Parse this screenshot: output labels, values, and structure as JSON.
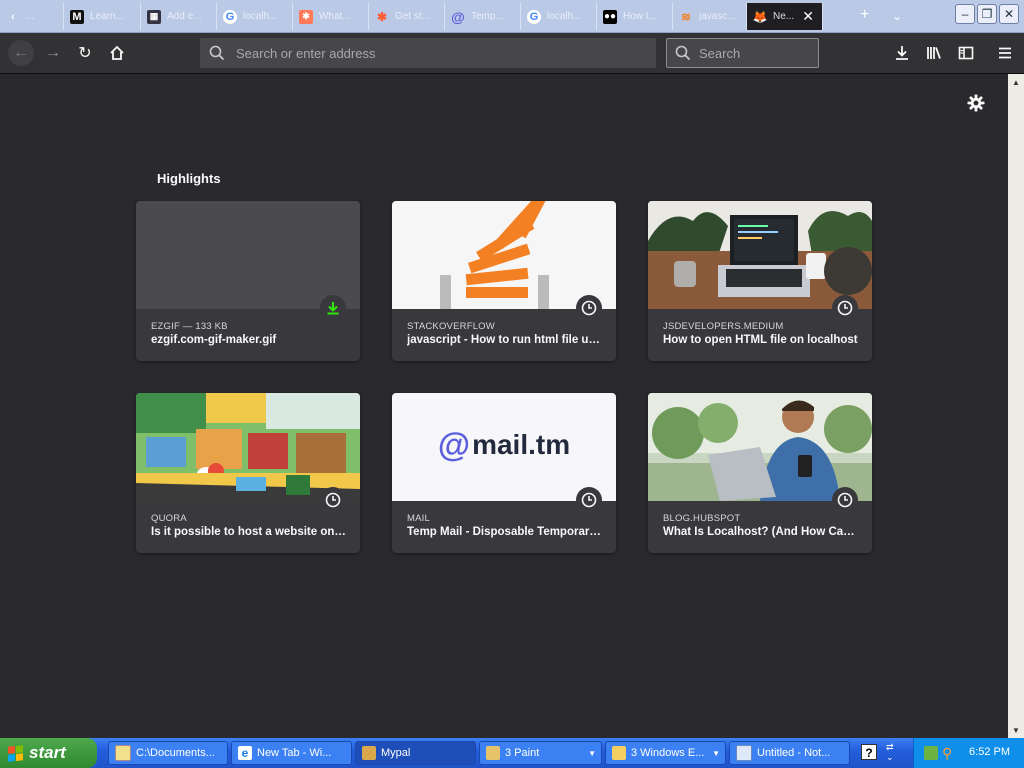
{
  "tabs": [
    {
      "label": "...",
      "icon": "tab-icon"
    },
    {
      "label": "Learn...",
      "icon": "medium-icon"
    },
    {
      "label": "Add e...",
      "icon": "grid-icon"
    },
    {
      "label": "localh...",
      "icon": "google-icon"
    },
    {
      "label": "What...",
      "icon": "hubspot-icon"
    },
    {
      "label": "Get st...",
      "icon": "hubspot-icon"
    },
    {
      "label": "Temp...",
      "icon": "at-icon"
    },
    {
      "label": "localh...",
      "icon": "google-icon"
    },
    {
      "label": "How t...",
      "icon": "medium-dots-icon"
    },
    {
      "label": "javasc...",
      "icon": "stackoverflow-icon"
    },
    {
      "label": "Ne...",
      "icon": "firefox-icon",
      "active": true
    }
  ],
  "toolbar": {
    "address_placeholder": "Search or enter address",
    "search_placeholder": "Search"
  },
  "highlights": {
    "title": "Highlights",
    "cards": [
      {
        "host": "EZGIF — 133 KB",
        "title": "ezgif.com-gif-maker.gif",
        "badge": "download"
      },
      {
        "host": "STACKOVERFLOW",
        "title": "javascript - How to run html file using node js - Stack Overflow",
        "badge": "history"
      },
      {
        "host": "JSDEVELOPERS.MEDIUM",
        "title": "How to open HTML file on localhost",
        "badge": "history"
      },
      {
        "host": "QUORA",
        "title": "Is it possible to host a website on localhost?",
        "badge": "history"
      },
      {
        "host": "MAIL",
        "title": "Temp Mail - Disposable Temporary Email",
        "badge": "history",
        "logo_text": "mail.tm"
      },
      {
        "host": "BLOG.HUBSPOT",
        "title": "What Is Localhost? (And How Can I Use It?)",
        "badge": "history"
      }
    ]
  },
  "taskbar": {
    "start_label": "start",
    "tasks": [
      {
        "label": "C:\\Documents...",
        "icon": "cmd-icon"
      },
      {
        "label": "New Tab - Wi...",
        "icon": "ie-icon"
      },
      {
        "label": "Mypal",
        "icon": "mypal-icon",
        "active": true
      },
      {
        "label": "3 Paint",
        "icon": "paint-icon"
      },
      {
        "label": "3 Windows E...",
        "icon": "folder-icon"
      },
      {
        "label": "Untitled - Not...",
        "icon": "notepad-icon"
      }
    ],
    "clock": "6:52 PM"
  },
  "colors": {
    "content_bg": "#2a2a2e",
    "card_bg": "#38383d",
    "download_green": "#30e60b",
    "taskbar_blue": "#245edc",
    "start_green": "#3c9a3c"
  }
}
